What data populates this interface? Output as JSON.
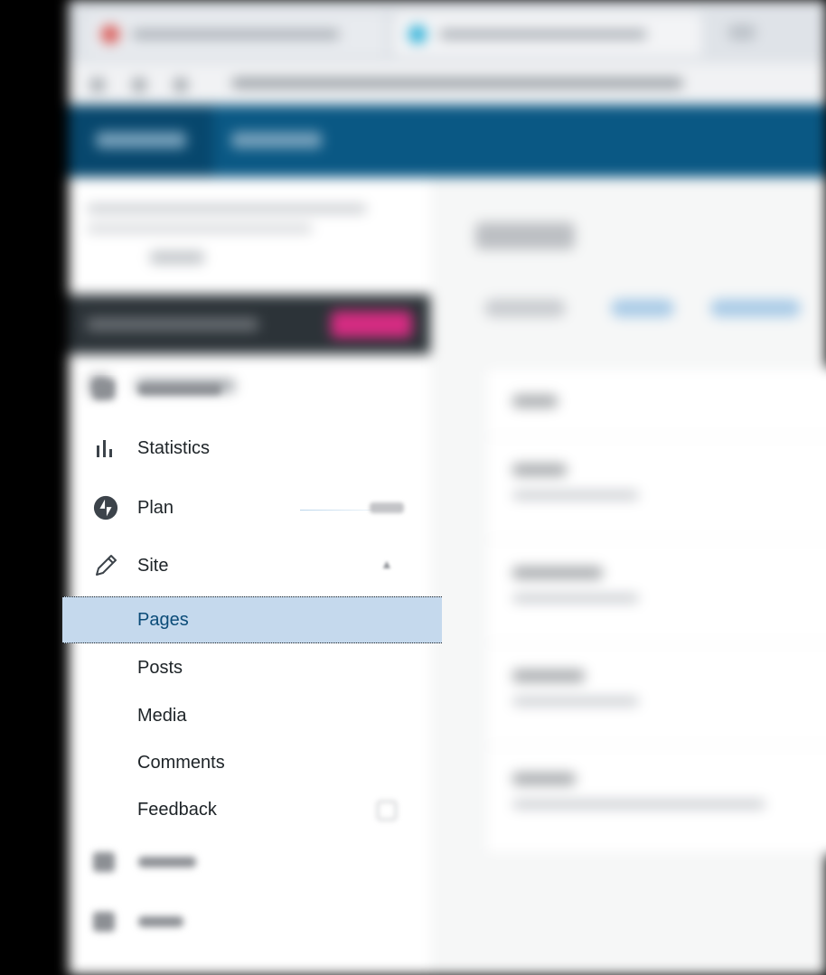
{
  "sidebar": {
    "items": [
      {
        "id": "statistics",
        "label": "Statistics",
        "icon": "bar-chart-icon"
      },
      {
        "id": "plan",
        "label": "Plan",
        "icon": "jetpack-bolt-icon"
      },
      {
        "id": "site",
        "label": "Site",
        "icon": "pencil-icon",
        "expanded": true
      },
      {
        "id": "pages",
        "label": "Pages",
        "active": true
      },
      {
        "id": "posts",
        "label": "Posts"
      },
      {
        "id": "media",
        "label": "Media"
      },
      {
        "id": "comments",
        "label": "Comments"
      },
      {
        "id": "feedback",
        "label": "Feedback"
      }
    ]
  },
  "colors": {
    "masterbar": "#0a5884",
    "active_bg": "#c5d9ed",
    "active_text": "#0a4b78",
    "promo_button": "#d52c82"
  }
}
